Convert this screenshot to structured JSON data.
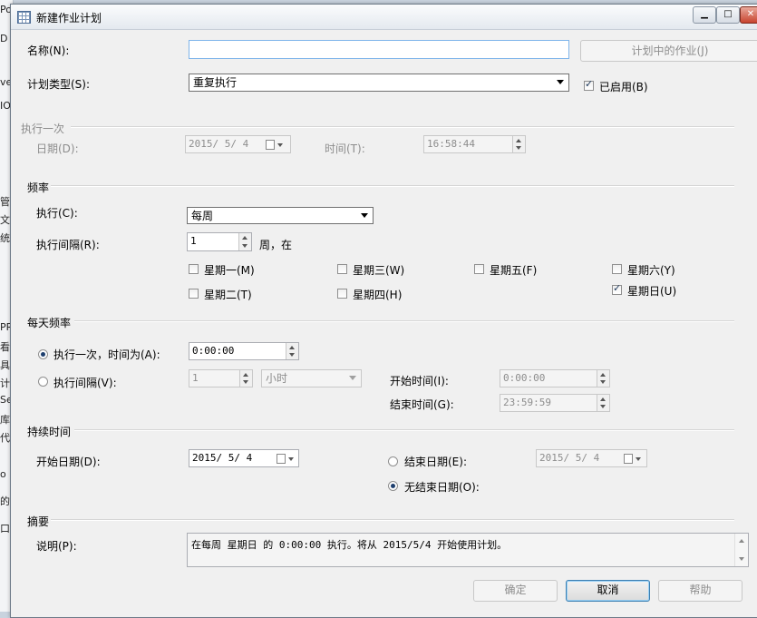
{
  "background_app": {
    "chars": [
      "Po",
      "D",
      "ver",
      "IO",
      "管",
      "文",
      "统",
      "PR",
      "看",
      "具",
      "计",
      "Se",
      "库",
      "代",
      "o",
      "的",
      "口"
    ]
  },
  "window": {
    "title": "新建作业计划",
    "minimize": "▁",
    "maximize": "□",
    "close": "✕"
  },
  "general": {
    "name_label": "名称(N):",
    "name_value": "",
    "jobs_in_schedule_button": "计划中的作业(J)",
    "schedule_type_label": "计划类型(S):",
    "schedule_type_value": "重复执行",
    "enabled_label": "已启用(B)",
    "enabled_checked": true
  },
  "once": {
    "header": "执行一次",
    "date_label": "日期(D):",
    "date_value": "2015/ 5/ 4",
    "time_label": "时间(T):",
    "time_value": "16:58:44"
  },
  "frequency": {
    "header": "频率",
    "occurs_label": "执行(C):",
    "occurs_value": "每周",
    "recurs_label": "执行间隔(R):",
    "recurs_value": "1",
    "recurs_unit": "周，在",
    "days": [
      {
        "label": "星期一(M)",
        "checked": false
      },
      {
        "label": "星期三(W)",
        "checked": false
      },
      {
        "label": "星期五(F)",
        "checked": false
      },
      {
        "label": "星期六(Y)",
        "checked": false
      },
      {
        "label": "星期二(T)",
        "checked": false
      },
      {
        "label": "星期四(H)",
        "checked": false
      },
      {
        "label": "星期日(U)",
        "checked": true
      }
    ]
  },
  "daily": {
    "header": "每天频率",
    "once_at_label": "执行一次，时间为(A):",
    "once_at_value": "0:00:00",
    "once_at_selected": true,
    "every_label": "执行间隔(V):",
    "every_value": "1",
    "every_unit": "小时",
    "every_selected": false,
    "start_label": "开始时间(I):",
    "start_value": "0:00:00",
    "end_label": "结束时间(G):",
    "end_value": "23:59:59"
  },
  "duration": {
    "header": "持续时间",
    "start_date_label": "开始日期(D):",
    "start_date_value": "2015/ 5/ 4",
    "end_date_label": "结束日期(E):",
    "end_date_value": "2015/ 5/ 4",
    "end_date_selected": false,
    "no_end_label": "无结束日期(O):",
    "no_end_selected": true
  },
  "summary": {
    "header": "摘要",
    "description_label": "说明(P):",
    "description_value": "在每周 星期日 的 0:00:00 执行。将从 2015/5/4 开始使用计划。"
  },
  "buttons": {
    "ok": "确定",
    "cancel": "取消",
    "help": "帮助"
  }
}
